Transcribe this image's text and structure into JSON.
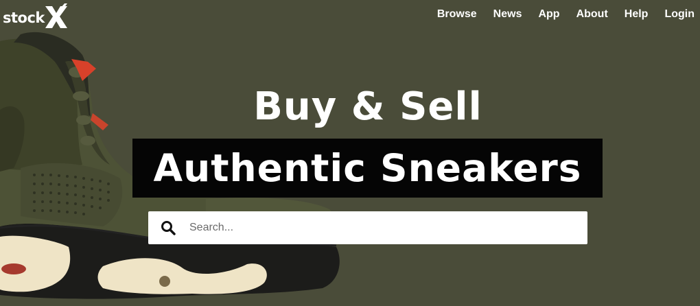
{
  "brand": {
    "logo_text": "stock",
    "logo_mark": "X"
  },
  "nav": {
    "items": [
      {
        "label": "Browse"
      },
      {
        "label": "News"
      },
      {
        "label": "App"
      },
      {
        "label": "About"
      },
      {
        "label": "Help"
      },
      {
        "label": "Login"
      }
    ]
  },
  "hero": {
    "headline_line1": "Buy & Sell",
    "headline_line2": "Authentic Sneakers",
    "background_color": "#4a4c39",
    "image": "sneaker-olive-nubuck-image"
  },
  "search": {
    "placeholder": "Search...",
    "value": "",
    "icon": "search-icon"
  }
}
